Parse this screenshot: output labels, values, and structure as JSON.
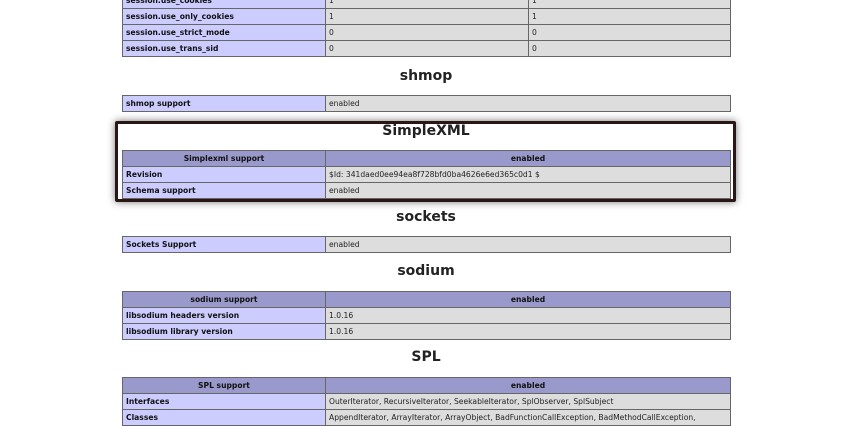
{
  "session_rows": [
    {
      "directive": "session.use_cookies",
      "local": "1",
      "master": "1"
    },
    {
      "directive": "session.use_only_cookies",
      "local": "1",
      "master": "1"
    },
    {
      "directive": "session.use_strict_mode",
      "local": "0",
      "master": "0"
    },
    {
      "directive": "session.use_trans_sid",
      "local": "0",
      "master": "0"
    }
  ],
  "shmop": {
    "title": "shmop",
    "rows": [
      {
        "key": "shmop support",
        "value": "enabled"
      }
    ]
  },
  "simplexml": {
    "title": "SimpleXML",
    "header": {
      "key": "Simplexml support",
      "value": "enabled"
    },
    "rows": [
      {
        "key": "Revision",
        "value": "$Id: 341daed0ee94ea8f728bfd0ba4626e6ed365c0d1 $"
      },
      {
        "key": "Schema support",
        "value": "enabled"
      }
    ]
  },
  "sockets": {
    "title": "sockets",
    "rows": [
      {
        "key": "Sockets Support",
        "value": "enabled"
      }
    ]
  },
  "sodium": {
    "title": "sodium",
    "header": {
      "key": "sodium support",
      "value": "enabled"
    },
    "rows": [
      {
        "key": "libsodium headers version",
        "value": "1.0.16"
      },
      {
        "key": "libsodium library version",
        "value": "1.0.16"
      }
    ]
  },
  "spl": {
    "title": "SPL",
    "header": {
      "key": "SPL support",
      "value": "enabled"
    },
    "rows": [
      {
        "key": "Interfaces",
        "value": "OuterIterator, RecursiveIterator, SeekableIterator, SplObserver, SplSubject"
      },
      {
        "key": "Classes",
        "value": "AppendIterator, ArrayIterator, ArrayObject, BadFunctionCallException, BadMethodCallException,"
      }
    ]
  },
  "colors": {
    "key_cell": "#ccccff",
    "value_cell": "#dddddd",
    "header_row": "#9999cc",
    "highlight_border": "#2a1616"
  }
}
